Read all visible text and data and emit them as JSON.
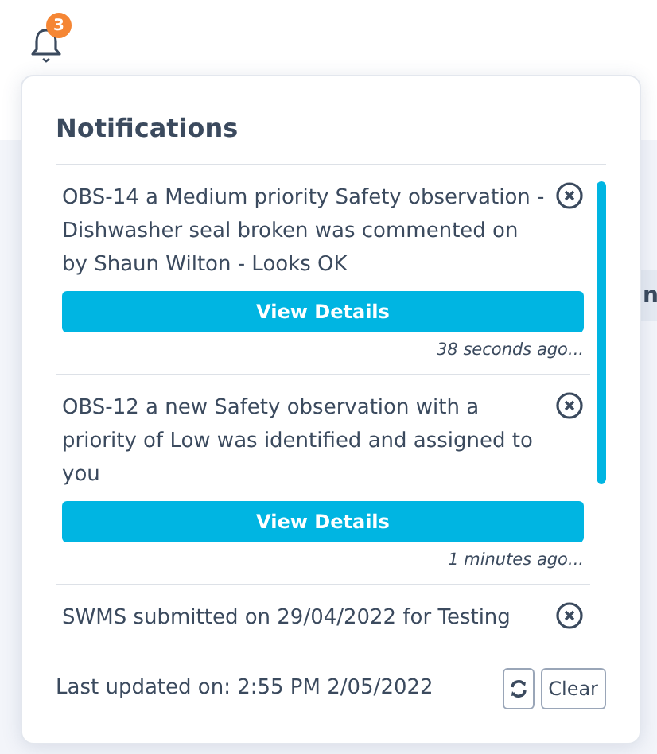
{
  "bell": {
    "badge": "3"
  },
  "background": {
    "column_header": "n"
  },
  "panel": {
    "title": "Notifications",
    "notifications": [
      {
        "message": "OBS-14 a Medium priority Safety observation - Dishwasher seal broken was commented on by Shaun Wilton - Looks OK",
        "button": "View Details",
        "time": "38 seconds ago..."
      },
      {
        "message": "OBS-12 a new Safety observation with a priority of Low was identified and assigned to you",
        "button": "View Details",
        "time": "1 minutes ago..."
      },
      {
        "message": "SWMS submitted on 29/04/2022 for Testing"
      }
    ],
    "footer": {
      "last_updated": "Last updated on: 2:55 PM 2/05/2022",
      "clear_button": "Clear"
    }
  }
}
